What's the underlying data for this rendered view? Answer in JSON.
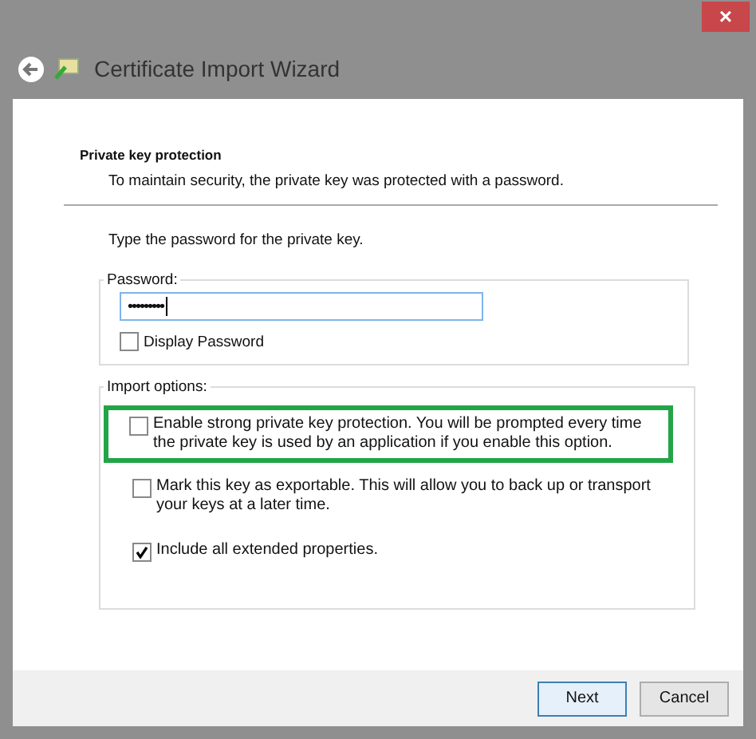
{
  "window": {
    "title": "Certificate Import Wizard",
    "close": "×"
  },
  "page": {
    "heading": "Private key protection",
    "subtitle": "To maintain security, the private key was protected with a password."
  },
  "prompt": "Type the password for the private key.",
  "password_group": {
    "label": "Password:",
    "value": "•••••••••",
    "display_password": {
      "label": "Display Password",
      "checked": false
    }
  },
  "import_options": {
    "label": "Import options:",
    "options": [
      {
        "label": "Enable strong private key protection. You will be prompted every time the private key is used by an application if you enable this option.",
        "checked": false,
        "highlighted": true
      },
      {
        "label": "Mark this key as exportable. This will allow you to back up or transport your keys at a later time.",
        "checked": false,
        "highlighted": false
      },
      {
        "label": "Include all extended properties.",
        "checked": true,
        "highlighted": false
      }
    ]
  },
  "buttons": [
    {
      "label": "Next",
      "default": true
    },
    {
      "label": "Cancel",
      "default": false
    }
  ]
}
